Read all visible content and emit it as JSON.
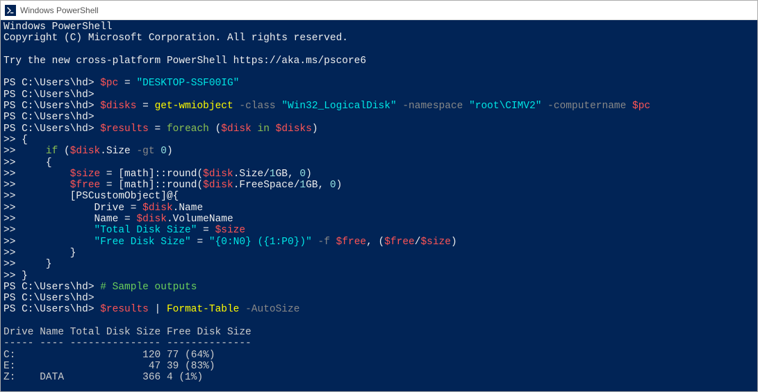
{
  "window": {
    "title": "Windows PowerShell"
  },
  "header": {
    "line1": "Windows PowerShell",
    "line2": "Copyright (C) Microsoft Corporation. All rights reserved.",
    "line3": "Try the new cross-platform PowerShell https://aka.ms/pscore6"
  },
  "prompt": "PS C:\\Users\\hd>",
  "cont": ">>",
  "cmd1": {
    "var_pc": "$pc",
    "eq": " = ",
    "val": "\"DESKTOP-SSF00IG\""
  },
  "cmd3": {
    "var_disks": "$disks",
    "eq": " = ",
    "cmd": "get-wmiobject",
    "p_class": " -class ",
    "v_class": "\"Win32_LogicalDisk\"",
    "p_ns": " -namespace ",
    "v_ns": "\"root\\CIMV2\"",
    "p_comp": " -computername ",
    "v_comp": "$pc"
  },
  "cmd5": {
    "var_results": "$results",
    "eq": " = ",
    "foreach": "foreach",
    "open": " (",
    "disk": "$disk",
    "in": " in ",
    "disks": "$disks",
    "close": ")"
  },
  "loop": {
    "brace_open": " {",
    "if": "     if ",
    "if_open": "(",
    "disk": "$disk",
    "dot_size": ".Size ",
    "gt": "-gt",
    "zero": " 0",
    "if_close": ")",
    "inner_open": "     {",
    "size_var": "         $size",
    "eq": " = ",
    "math1_a": "[math]::round(",
    "disk2": "$disk",
    "dot_size2": ".Size/",
    "gb1": "1",
    "gb1b": "GB",
    "math1_b": ", ",
    "zero2": "0",
    "math1_c": ")",
    "free_var": "         $free",
    "math2_a": "[math]::round(",
    "disk3": "$disk",
    "dot_free": ".FreeSpace/",
    "gb2": "1",
    "gb2b": "GB",
    "math2_b": ", ",
    "zero3": "0",
    "math2_c": ")",
    "psco": "         [PSCustomObject]@{",
    "drive_lbl": "             Drive = ",
    "disk4": "$disk",
    "dot_name": ".Name",
    "name_lbl": "             Name = ",
    "disk5": "$disk",
    "dot_vol": ".VolumeName",
    "tds": "             \"Total Disk Size\"",
    "tds_eq": " = ",
    "size_var2": "$size",
    "fds": "             \"Free Disk Size\"",
    "fds_eq": " = ",
    "fmt": "\"{0:N0} ({1:P0})\"",
    "f_op": " -f ",
    "free2": "$free",
    "comma": ", (",
    "free3": "$free",
    "slash": "/",
    "size3": "$size",
    "close2": ")",
    "inner_close1": "         }",
    "inner_close2": "     }",
    "brace_close": " }"
  },
  "comment": "# Sample outputs",
  "cmd_last": {
    "results": "$results",
    "pipe": " | ",
    "ft": "Format-Table",
    "auto": " -AutoSize"
  },
  "table": {
    "header": "Drive Name Total Disk Size Free Disk Size",
    "sep": "----- ---- --------------- --------------",
    "row1": "C:                     120 77 (64%)",
    "row2": "E:                      47 39 (83%)",
    "row3": "Z:    DATA             366 4 (1%)"
  }
}
